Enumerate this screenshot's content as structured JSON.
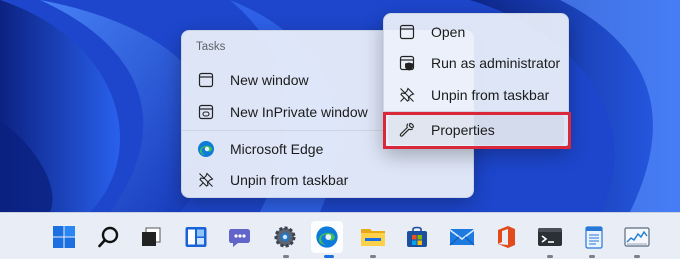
{
  "jumplist": {
    "heading": "Tasks",
    "items": [
      {
        "label": "New window",
        "icon": "window-icon"
      },
      {
        "label": "New InPrivate window",
        "icon": "inprivate-window-icon"
      },
      {
        "label": "Microsoft Edge",
        "icon": "edge-icon"
      },
      {
        "label": "Unpin from taskbar",
        "icon": "unpin-icon"
      }
    ]
  },
  "appmenu": {
    "items": [
      {
        "label": "Open",
        "icon": "window-icon"
      },
      {
        "label": "Run as administrator",
        "icon": "shield-icon"
      },
      {
        "label": "Unpin from taskbar",
        "icon": "unpin-icon"
      },
      {
        "label": "Properties",
        "icon": "wrench-icon"
      }
    ],
    "selected": "Properties"
  },
  "taskbar": {
    "icons": [
      "windows-start-icon",
      "search-icon",
      "task-view-icon",
      "widgets-icon",
      "teams-chat-icon",
      "settings-gear-icon",
      "edge-icon",
      "file-explorer-icon",
      "microsoft-store-icon",
      "mail-icon",
      "office-icon",
      "terminal-icon",
      "notepad-icon",
      "task-manager-icon"
    ],
    "active": "edge-icon"
  },
  "colors": {
    "highlight_border": "#d9283a",
    "edge_blue": "#0c7bd9",
    "edge_green": "#3fbd5b"
  }
}
